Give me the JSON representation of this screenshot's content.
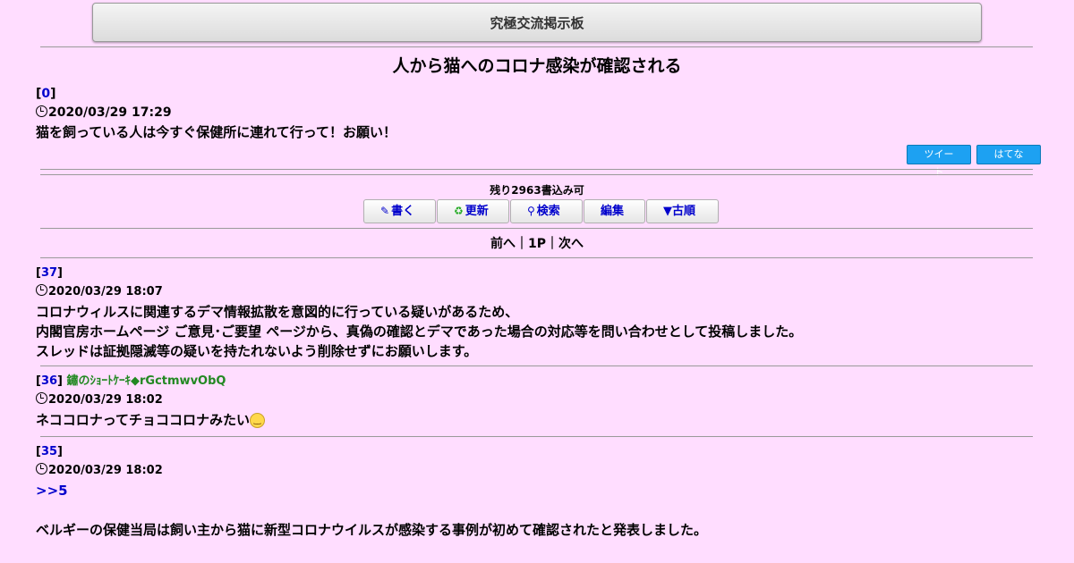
{
  "board": {
    "title": "究極交流掲示板"
  },
  "thread": {
    "title": "人から猫へのコロナ感染が確認される"
  },
  "op": {
    "number": "0",
    "date": "2020/03/29 17:29",
    "body": "猫を飼っている人は今すぐ保健所に連れて行って！お願い！"
  },
  "share": {
    "tweet_label": "ツイート",
    "hatena_label": "はてな"
  },
  "status": {
    "remaining": "残り2963書込み可"
  },
  "menu": {
    "write": "書く",
    "refresh": "更新",
    "search": "検索",
    "edit": "編集",
    "old": "▼古順"
  },
  "pager": {
    "prev": "前へ",
    "sep1": "｜",
    "page": "1P",
    "sep2": "｜",
    "next": "次へ"
  },
  "posts": [
    {
      "number": "37",
      "name": "",
      "date": "2020/03/29 18:07",
      "lines": [
        "コロナウィルスに関連するデマ情報拡散を意図的に行っている疑いがあるため、",
        "内閣官房ホームページ ご意見･ご要望 ページから、真偽の確認とデマであった場合の対応等を問い合わせとして投稿しました。",
        "スレッドは証拠隠滅等の疑いを持たれないよう削除せずにお願いします。"
      ]
    },
    {
      "number": "36",
      "name": "鏽のｼｮｰﾄｹｰｷ◆rGctmwvObQ",
      "date": "2020/03/29 18:02",
      "lines": [
        "ネココロナってチョココロナみたい"
      ],
      "emoji": "smiling-face"
    },
    {
      "number": "35",
      "name": "",
      "date": "2020/03/29 18:02",
      "anchor": ">>5",
      "lines": [
        "ベルギーの保健当局は飼い主から猫に新型コロナウイルスが感染する事例が初めて確認されたと発表しました。"
      ]
    }
  ]
}
